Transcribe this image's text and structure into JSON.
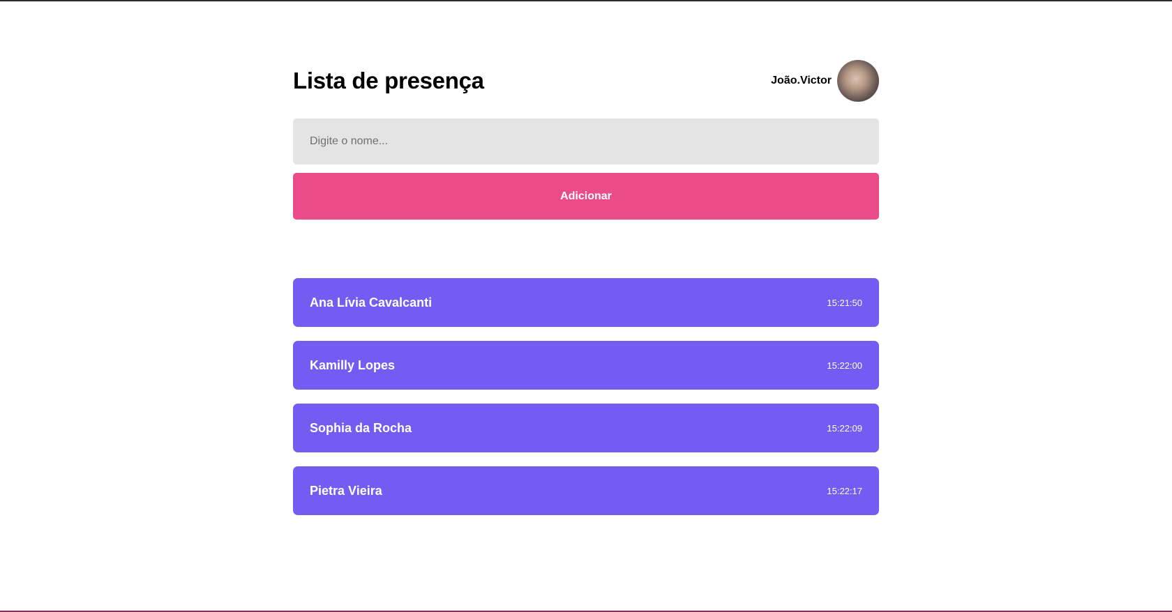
{
  "page": {
    "title": "Lista de presença"
  },
  "user": {
    "name": "João.Victor"
  },
  "form": {
    "input_placeholder": "Digite o nome...",
    "input_value": "",
    "add_label": "Adicionar"
  },
  "students": [
    {
      "name": "Ana Lívia Cavalcanti",
      "time": "15:21:50"
    },
    {
      "name": "Kamilly Lopes",
      "time": "15:22:00"
    },
    {
      "name": "Sophia da Rocha",
      "time": "15:22:09"
    },
    {
      "name": "Pietra Vieira",
      "time": "15:22:17"
    }
  ],
  "colors": {
    "accent_button": "#ea4c89",
    "card": "#745cf2",
    "input_bg": "#e4e4e4"
  }
}
